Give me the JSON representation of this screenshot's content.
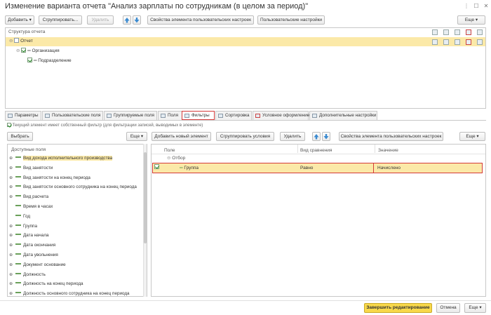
{
  "window": {
    "title": "Изменение варианта отчета \"Анализ зарплаты по сотрудникам (в целом за период)\""
  },
  "toolbar": {
    "add": "Добавить",
    "group": "Сгруппировать...",
    "delete": "Удалить",
    "props": "Свойства элемента пользовательских настроек",
    "user_settings": "Пользовательские настройки",
    "more": "Еще"
  },
  "structure": {
    "header": "Структура отчета",
    "items": [
      {
        "label": "Отчет",
        "level": 0
      },
      {
        "label": "Организация",
        "level": 1
      },
      {
        "label": "Подразделение",
        "level": 2
      }
    ]
  },
  "tabs": [
    {
      "label": "Параметры"
    },
    {
      "label": "Пользовательские поля"
    },
    {
      "label": "Группируемые поля"
    },
    {
      "label": "Поля"
    },
    {
      "label": "Фильтры"
    },
    {
      "label": "Сортировка"
    },
    {
      "label": "Условное оформление"
    },
    {
      "label": "Дополнительные настройки"
    }
  ],
  "active_tab": "Фильтры",
  "filter_panel": {
    "own_filter_note": "Текущий элемент имеет собственный фильтр (для фильтрации записей, выводимых в элементе)",
    "select_btn": "Выбрать",
    "more": "Еще",
    "add_new": "Добавить новый элемент",
    "group_conditions": "Сгруппировать условия",
    "delete": "Удалить",
    "props": "Свойства элемента пользовательских настроек",
    "more2": "Еще"
  },
  "available_fields": {
    "header": "Доступные поля",
    "items": [
      {
        "label": "Вид дохода исполнительного производства",
        "expandable": true
      },
      {
        "label": "Вид занятости",
        "expandable": true
      },
      {
        "label": "Вид занятости на конец периода",
        "expandable": true
      },
      {
        "label": "Вид занятости основного сотрудника на конец периода",
        "expandable": true
      },
      {
        "label": "Вид расчета",
        "expandable": true
      },
      {
        "label": "Время в часах",
        "expandable": false
      },
      {
        "label": "Год",
        "expandable": false
      },
      {
        "label": "Группа",
        "expandable": true
      },
      {
        "label": "Дата начала",
        "expandable": true
      },
      {
        "label": "Дата окончания",
        "expandable": true
      },
      {
        "label": "Дата увольнения",
        "expandable": true
      },
      {
        "label": "Документ основание",
        "expandable": true
      },
      {
        "label": "Должность",
        "expandable": true
      },
      {
        "label": "Должность на конец периода",
        "expandable": true
      },
      {
        "label": "Должность основного сотрудника на конец периода",
        "expandable": true
      }
    ]
  },
  "filter_grid": {
    "columns": [
      "Поле",
      "Вид сравнения",
      "Значение"
    ],
    "group_row": "Отбор",
    "rows": [
      {
        "field": "Группа",
        "comparison": "Равно",
        "value": "Начислено",
        "checked": true
      }
    ]
  },
  "footer": {
    "finish": "Завершить редактирование",
    "cancel": "Отмена",
    "more": "Еще"
  }
}
